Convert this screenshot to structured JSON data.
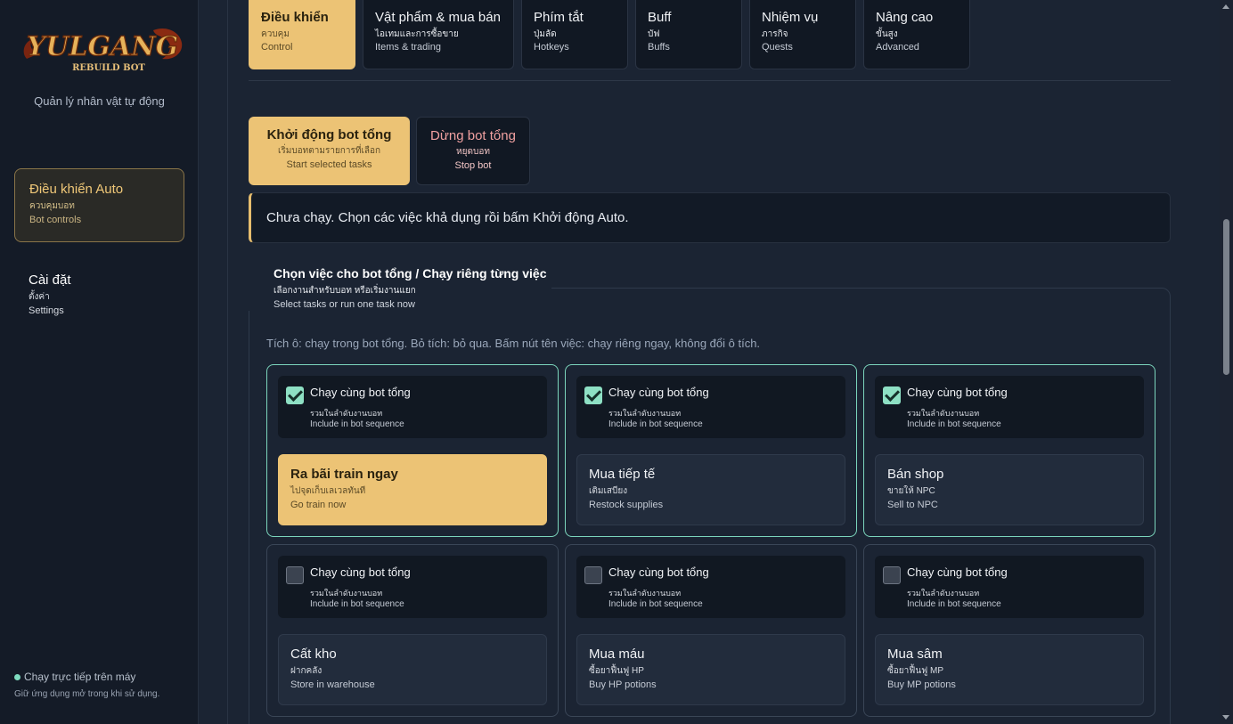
{
  "sidebar": {
    "logo_text": "YULGANG",
    "logo_subtext": "REBUILD BOT",
    "tagline": "Quản lý nhân vật tự động",
    "nav": [
      {
        "label": "Điều khiển Auto",
        "thai": "ควบคุมบอท",
        "en": "Bot controls"
      },
      {
        "label": "Cài đặt",
        "thai": "ตั้งค่า",
        "en": "Settings"
      }
    ],
    "status": {
      "label": "Chạy trực tiếp trên máy",
      "note": "Giữ ứng dụng mở trong khi sử dụng."
    }
  },
  "tabs": [
    {
      "label": "Điều khiển",
      "thai": "ควบคุม",
      "en": "Control"
    },
    {
      "label": "Vật phẩm & mua bán",
      "thai": "ไอเทมและการซื้อขาย",
      "en": "Items & trading"
    },
    {
      "label": "Phím tắt",
      "thai": "ปุ่มลัด",
      "en": "Hotkeys"
    },
    {
      "label": "Buff",
      "thai": "บัฟ",
      "en": "Buffs"
    },
    {
      "label": "Nhiệm vụ",
      "thai": "ภารกิจ",
      "en": "Quests"
    },
    {
      "label": "Nâng cao",
      "thai": "ขั้นสูง",
      "en": "Advanced"
    }
  ],
  "controls": {
    "start": {
      "label": "Khởi động bot tổng",
      "thai": "เริ่มบอทตามรายการที่เลือก",
      "en": "Start selected tasks"
    },
    "stop": {
      "label": "Dừng bot tổng",
      "thai": "หยุดบอท",
      "en": "Stop bot"
    }
  },
  "notice": "Chưa chạy. Chọn các việc khả dụng rồi bấm Khởi động Auto.",
  "task_section": {
    "title": "Chọn việc cho bot tổng / Chạy riêng từng việc",
    "thai": "เลือกงานสำหรับบอท หรือเริ่มงานแยก",
    "en": "Select tasks or run one task now",
    "hint": "Tích ô: chạy trong bot tổng. Bỏ tích: bỏ qua. Bấm nút tên việc: chạy riêng ngay, không đổi ô tích."
  },
  "include": {
    "label": "Chạy cùng bot tổng",
    "thai": "รวมในลำดับงานบอท",
    "en": "Include in bot sequence"
  },
  "tasks": [
    {
      "label": "Ra bãi train ngay",
      "thai": "ไปจุดเก็บเลเวลทันที",
      "en": "Go train now",
      "checked": true
    },
    {
      "label": "Mua tiếp tế",
      "thai": "เติมเสบียง",
      "en": "Restock supplies",
      "checked": true
    },
    {
      "label": "Bán shop",
      "thai": "ขายให้ NPC",
      "en": "Sell to NPC",
      "checked": true
    },
    {
      "label": "Cất kho",
      "thai": "ฝากคลัง",
      "en": "Store in warehouse",
      "checked": false
    },
    {
      "label": "Mua máu",
      "thai": "ซื้อยาฟื้นฟู HP",
      "en": "Buy HP potions",
      "checked": false
    },
    {
      "label": "Mua sâm",
      "thai": "ซื้อยาฟื้นฟู MP",
      "en": "Buy MP potions",
      "checked": false
    }
  ],
  "colors": {
    "accent": "#ecc375",
    "selected_border": "#7cd6bd",
    "background": "#1b2433"
  }
}
